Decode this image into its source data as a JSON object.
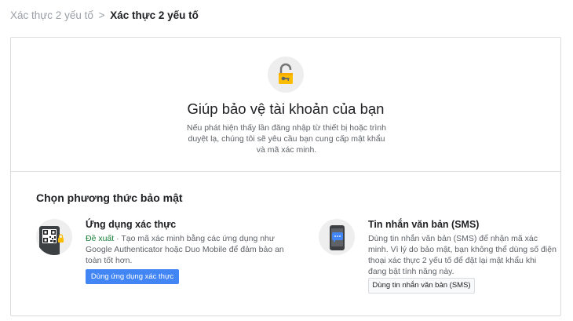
{
  "breadcrumb": {
    "parent": "Xác thực 2 yếu tố",
    "separator": ">",
    "current": "Xác thực 2 yếu tố"
  },
  "hero": {
    "icon": "unlocked-padlock-icon",
    "title": "Giúp bảo vệ tài khoản của bạn",
    "description": "Nếu phát hiện thấy lần đăng nhập từ thiết bị hoặc trình duyệt lạ, chúng tôi sẽ yêu cầu bạn cung cấp mật khẩu và mã xác minh."
  },
  "section": {
    "title": "Chọn phương thức bảo mật"
  },
  "methods": [
    {
      "icon": "authenticator-qr-phone-icon",
      "title": "Ứng dụng xác thực",
      "badge": "Đề xuất",
      "description": " · Tạo mã xác minh bằng các ứng dụng như Google Authenticator hoặc Duo Mobile để đảm bảo an toàn tốt hơn.",
      "button_label": "Dùng ứng dụng xác thực"
    },
    {
      "icon": "sms-phone-icon",
      "title": "Tin nhắn văn bản (SMS)",
      "description": "Dùng tin nhắn văn bản (SMS) để nhận mã xác minh. Vì lý do bảo mật, bạn không thể dùng số điện thoại xác thực 2 yếu tố để đặt lại mật khẩu khi đang bật tính năng này.",
      "button_label": "Dùng tin nhắn văn bản (SMS)"
    }
  ],
  "colors": {
    "primary_button": "#4285f4",
    "recommended": "#188038",
    "lock": "#fbbc04"
  }
}
